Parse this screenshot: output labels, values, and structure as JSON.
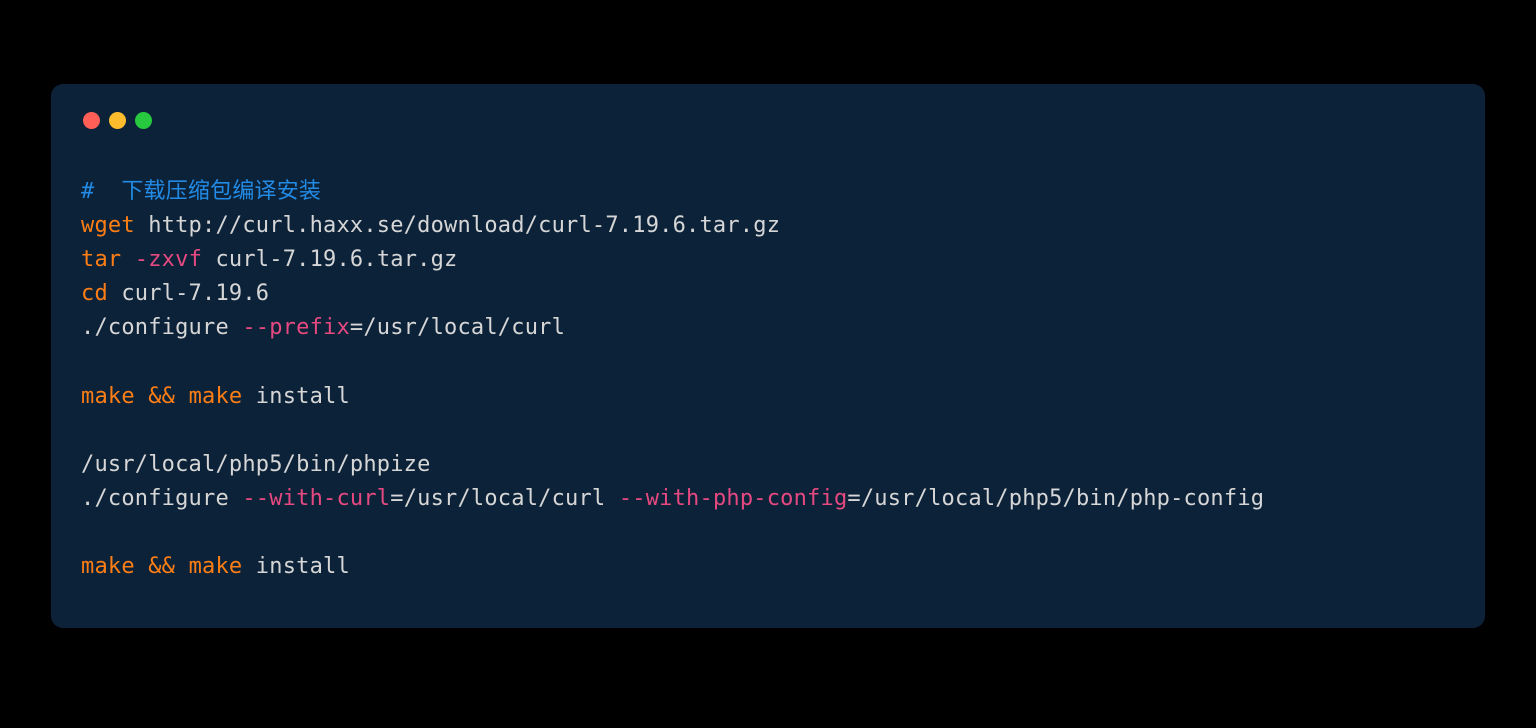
{
  "code": {
    "lines": [
      [
        {
          "cls": "tok-comment",
          "t": "#  下载压缩包编译安装"
        }
      ],
      [
        {
          "cls": "tok-command",
          "t": "wget"
        },
        {
          "cls": "tok-text",
          "t": " http://curl.haxx.se/download/curl-7.19.6.tar.gz"
        }
      ],
      [
        {
          "cls": "tok-command",
          "t": "tar"
        },
        {
          "cls": "tok-text",
          "t": " "
        },
        {
          "cls": "tok-option",
          "t": "-zxvf"
        },
        {
          "cls": "tok-text",
          "t": " curl-7.19.6.tar.gz"
        }
      ],
      [
        {
          "cls": "tok-command",
          "t": "cd"
        },
        {
          "cls": "tok-text",
          "t": " curl-7.19.6"
        }
      ],
      [
        {
          "cls": "tok-text",
          "t": "./configure "
        },
        {
          "cls": "tok-option",
          "t": "--prefix"
        },
        {
          "cls": "tok-text",
          "t": "=/usr/local/curl"
        }
      ],
      [
        {
          "cls": "tok-text",
          "t": " "
        }
      ],
      [
        {
          "cls": "tok-command",
          "t": "make"
        },
        {
          "cls": "tok-text",
          "t": " "
        },
        {
          "cls": "tok-operator",
          "t": "&&"
        },
        {
          "cls": "tok-text",
          "t": " "
        },
        {
          "cls": "tok-command",
          "t": "make"
        },
        {
          "cls": "tok-text",
          "t": " install"
        }
      ],
      [
        {
          "cls": "tok-text",
          "t": " "
        }
      ],
      [
        {
          "cls": "tok-text",
          "t": "/usr/local/php5/bin/phpize"
        }
      ],
      [
        {
          "cls": "tok-text",
          "t": "./configure "
        },
        {
          "cls": "tok-option",
          "t": "--with-curl"
        },
        {
          "cls": "tok-text",
          "t": "=/usr/local/curl "
        },
        {
          "cls": "tok-option",
          "t": "--with-php-config"
        },
        {
          "cls": "tok-text",
          "t": "=/usr/local/php5/bin/php-config"
        }
      ],
      [
        {
          "cls": "tok-text",
          "t": " "
        }
      ],
      [
        {
          "cls": "tok-command",
          "t": "make"
        },
        {
          "cls": "tok-text",
          "t": " "
        },
        {
          "cls": "tok-operator",
          "t": "&&"
        },
        {
          "cls": "tok-text",
          "t": " "
        },
        {
          "cls": "tok-command",
          "t": "make"
        },
        {
          "cls": "tok-text",
          "t": " install"
        }
      ]
    ]
  }
}
